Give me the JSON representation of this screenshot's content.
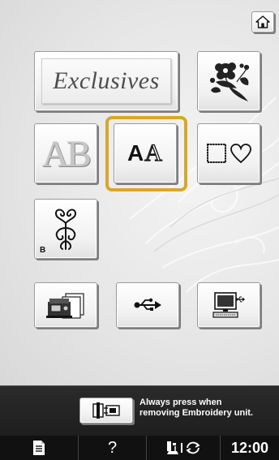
{
  "header": {
    "home_icon": "home-icon"
  },
  "categories": {
    "exclusives_label": "Exclusives",
    "flower_icon": "floral-embroidery-icon",
    "alphabet_icon": "decorative-alphabet-icon",
    "ab_text": "AB",
    "character_icon": "character-font-icon",
    "aa_bold": "A",
    "aa_outline": "A",
    "frame_icon": "frame-pattern-icon",
    "b_pattern_icon": "ornament-pattern-icon",
    "b_label": "B",
    "selected": "character-font"
  },
  "sources": {
    "machine_icon": "machine-memory-icon",
    "usb_icon": "usb-icon",
    "pc_icon": "computer-icon"
  },
  "notice": {
    "release_icon": "embroidery-unit-release-icon",
    "line1": "Always press when",
    "line2": "removing Embroidery unit."
  },
  "status_bar": {
    "doc_icon": "document-icon",
    "help_label": "?",
    "presser_icon": "presser-foot-icon",
    "rotate_icon": "rotate-arrows-icon",
    "clock": "12:00"
  },
  "colors": {
    "selection": "#d6a82a",
    "notice_bg": "#222222",
    "status_bg": "#111111"
  }
}
